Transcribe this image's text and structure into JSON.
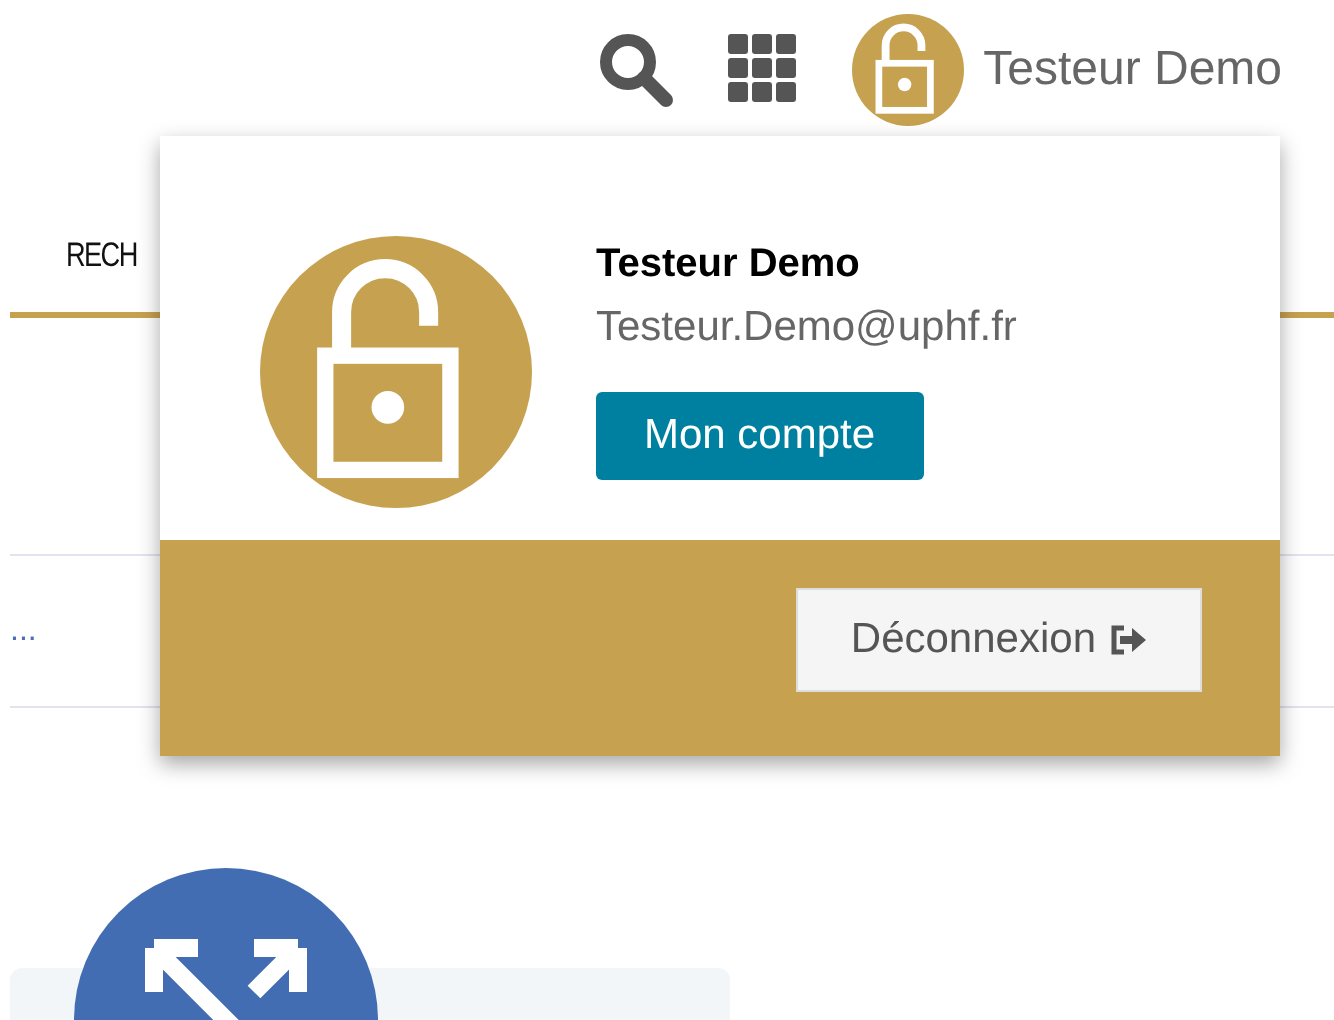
{
  "header": {
    "user_name": "Testeur Demo"
  },
  "nav": {
    "tab_label": "RECH"
  },
  "background": {
    "list_text": "..."
  },
  "user_menu": {
    "name": "Testeur Demo",
    "email": "Testeur.Demo@uphf.fr",
    "account_button": "Mon compte",
    "logout_button": "Déconnexion"
  }
}
